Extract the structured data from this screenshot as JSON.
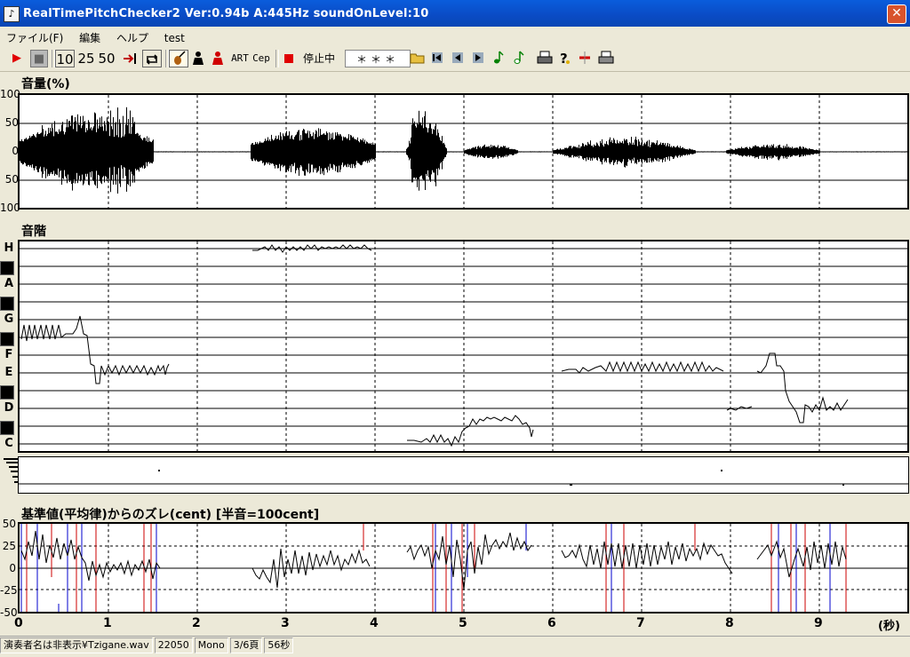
{
  "window": {
    "title": "RealTimePitchChecker2   Ver:0.94b     A:445Hz    soundOnLevel:10",
    "app_icon": "app-icon",
    "close": "✕"
  },
  "menu": [
    "ファイル(F)",
    "編集",
    "ヘルプ",
    "test"
  ],
  "toolbar": {
    "play": "▶",
    "stop": "■",
    "speed_10": "10",
    "speed_25": "25",
    "speed_50": "50",
    "art": "ART",
    "cep": "Cep",
    "status": "停止中",
    "display": "＊＊＊"
  },
  "volume_panel": {
    "title": "音量(%)",
    "y_labels": [
      "100",
      "50",
      "0",
      "50",
      "100"
    ]
  },
  "scale_panel": {
    "title": "音階",
    "notes": [
      "H",
      "A",
      "G",
      "F",
      "E",
      "D",
      "C"
    ]
  },
  "cent_panel": {
    "title": "基準値(平均律)からのズレ(cent) [半音=100cent]",
    "y_labels": [
      "50",
      "25",
      "0",
      "-25",
      "-50"
    ]
  },
  "time_axis": {
    "labels": [
      "0",
      "1",
      "2",
      "3",
      "4",
      "5",
      "6",
      "7",
      "8",
      "9"
    ],
    "unit": "(秒)"
  },
  "status_bar": [
    "演奏者名は非表示¥Tzigane.wav",
    "22050",
    "Mono",
    "3/6頁",
    "56秒"
  ],
  "colors": {
    "title_bar": "#0a52d4",
    "play": "#e00000",
    "cent_red": "#cc0000",
    "cent_blue": "#0000cc"
  }
}
